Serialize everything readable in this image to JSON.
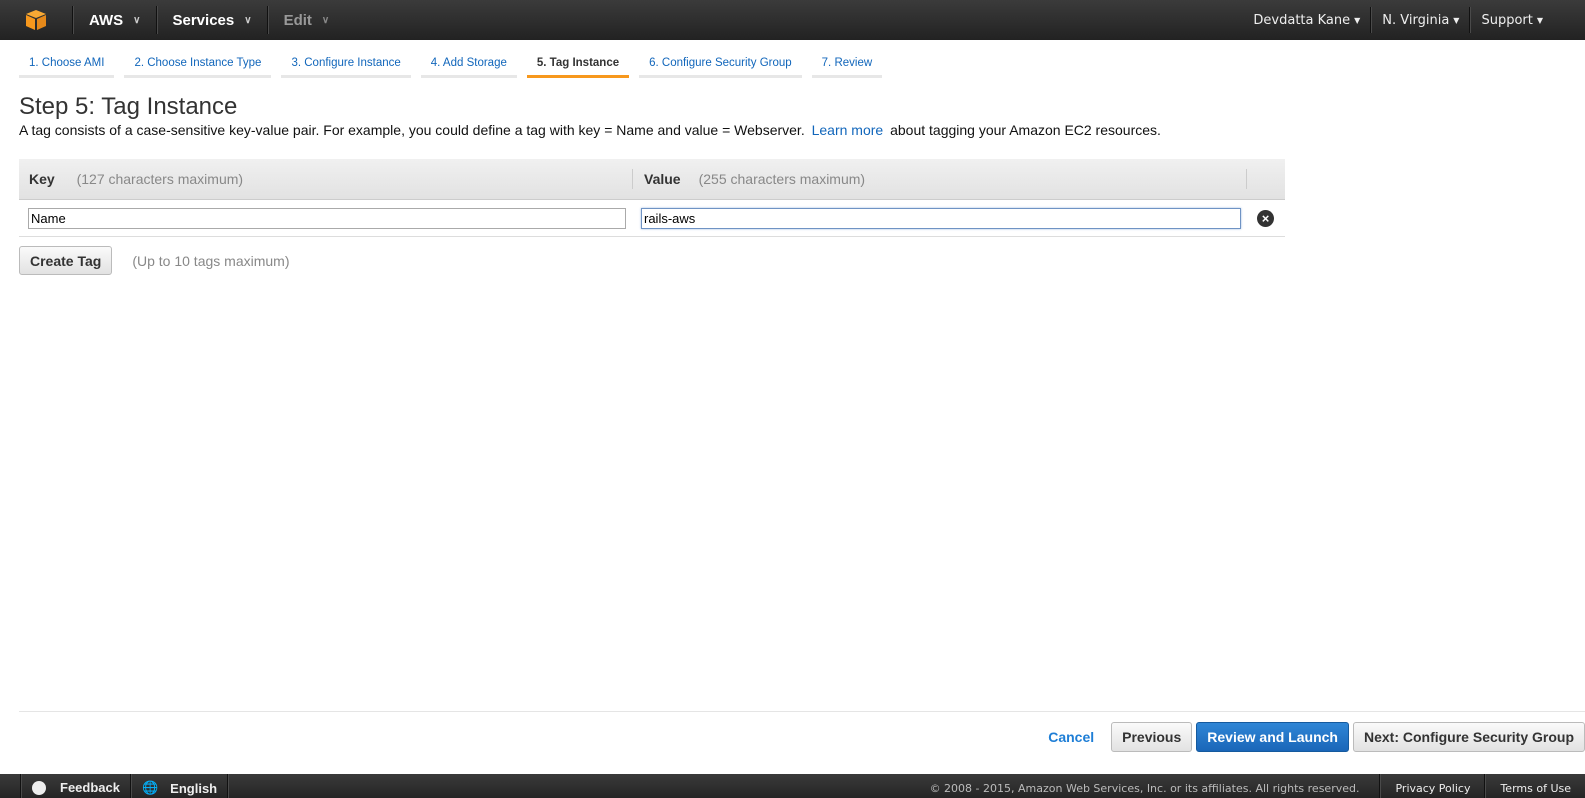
{
  "topnav": {
    "logo_icon": "aws-cube-icon",
    "items": [
      {
        "label": "AWS",
        "disabled": false
      },
      {
        "label": "Services",
        "disabled": false
      },
      {
        "label": "Edit",
        "disabled": true
      }
    ],
    "right": [
      {
        "label": "Devdatta Kane"
      },
      {
        "label": "N. Virginia"
      },
      {
        "label": "Support"
      }
    ]
  },
  "wizard": {
    "tabs": [
      {
        "label": "1. Choose AMI"
      },
      {
        "label": "2. Choose Instance Type"
      },
      {
        "label": "3. Configure Instance"
      },
      {
        "label": "4. Add Storage"
      },
      {
        "label": "5. Tag Instance",
        "active": true
      },
      {
        "label": "6. Configure Security Group"
      },
      {
        "label": "7. Review"
      }
    ]
  },
  "page": {
    "title": "Step 5: Tag Instance",
    "desc_before": "A tag consists of a case-sensitive key-value pair. For example, you could define a tag with key = Name and value = Webserver.",
    "desc_link": "Learn more",
    "desc_after": "about tagging your Amazon EC2 resources."
  },
  "tag_table": {
    "key_header": "Key",
    "key_hint": "(127 characters maximum)",
    "value_header": "Value",
    "value_hint": "(255 characters maximum)",
    "rows": [
      {
        "key": "Name",
        "value": "rails-aws"
      }
    ],
    "remove_icon": "remove-circle-icon"
  },
  "create_tag": {
    "button_label": "Create Tag",
    "hint": "(Up to 10 tags maximum)"
  },
  "actions": {
    "cancel": "Cancel",
    "previous": "Previous",
    "review_launch": "Review and Launch",
    "next": "Next: Configure Security Group"
  },
  "footer": {
    "feedback": "Feedback",
    "language": "English",
    "copyright": "© 2008 - 2015, Amazon Web Services, Inc. or its affiliates. All rights reserved.",
    "privacy": "Privacy Policy",
    "terms": "Terms of Use"
  },
  "colors": {
    "accent_orange": "#f7981d",
    "link_blue": "#1166bb",
    "primary_button": "#1a66b8"
  }
}
